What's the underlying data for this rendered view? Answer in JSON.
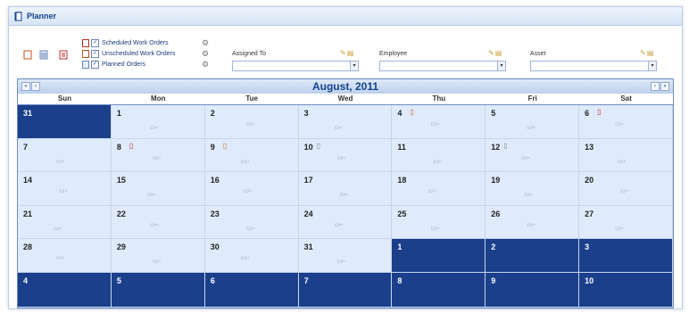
{
  "window": {
    "title": "Planner"
  },
  "toolbar": {
    "rows": [
      {
        "label": "Scheduled Work Orders"
      },
      {
        "label": "Unscheduled Work Orders"
      },
      {
        "label": "Planned Orders"
      }
    ],
    "filters": [
      {
        "label": "Assigned To"
      },
      {
        "label": "Employee"
      },
      {
        "label": "Asset"
      }
    ]
  },
  "calendar": {
    "title": "August, 2011",
    "dow": [
      "Sun",
      "Mon",
      "Tue",
      "Wed",
      "Thu",
      "Fri",
      "Sat"
    ],
    "days": [
      "31",
      "1",
      "2",
      "3",
      "4",
      "5",
      "6",
      "7",
      "8",
      "9",
      "10",
      "11",
      "12",
      "13",
      "14",
      "15",
      "16",
      "17",
      "18",
      "19",
      "20",
      "21",
      "22",
      "23",
      "24",
      "25",
      "26",
      "27",
      "28",
      "29",
      "30",
      "31",
      "1",
      "2",
      "3",
      "4",
      "5",
      "6",
      "7",
      "8",
      "9",
      "10"
    ],
    "other_month": [
      0,
      32,
      33,
      34,
      35,
      36,
      37,
      38,
      39,
      40,
      41
    ],
    "events": {
      "4": "orange",
      "6": "red",
      "8": "red",
      "9": "orange",
      "10": "gray",
      "12": "gray"
    }
  },
  "colors": {
    "accent": "#15428b",
    "cell": "#dfeafb",
    "other_month": "#1b3f8b"
  }
}
